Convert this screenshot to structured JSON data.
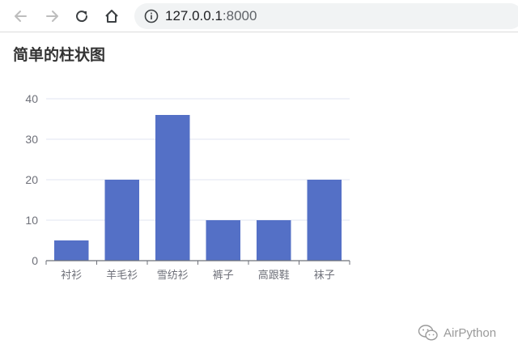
{
  "browser": {
    "url_host": "127.0.0.1",
    "url_port": ":8000"
  },
  "page": {
    "title": "简单的柱状图"
  },
  "watermark": {
    "text": "AirPython"
  },
  "colors": {
    "bar": "#5470c6",
    "axis": "#6e7079",
    "grid": "#e0e6f1",
    "label": "#6e7079"
  },
  "chart_data": {
    "type": "bar",
    "categories": [
      "衬衫",
      "羊毛衫",
      "雪纺衫",
      "裤子",
      "高跟鞋",
      "袜子"
    ],
    "values": [
      5,
      20,
      36,
      10,
      10,
      20
    ],
    "ylim": [
      0,
      40
    ],
    "yticks": [
      0,
      10,
      20,
      30,
      40
    ],
    "grid": true,
    "legend": "none"
  }
}
